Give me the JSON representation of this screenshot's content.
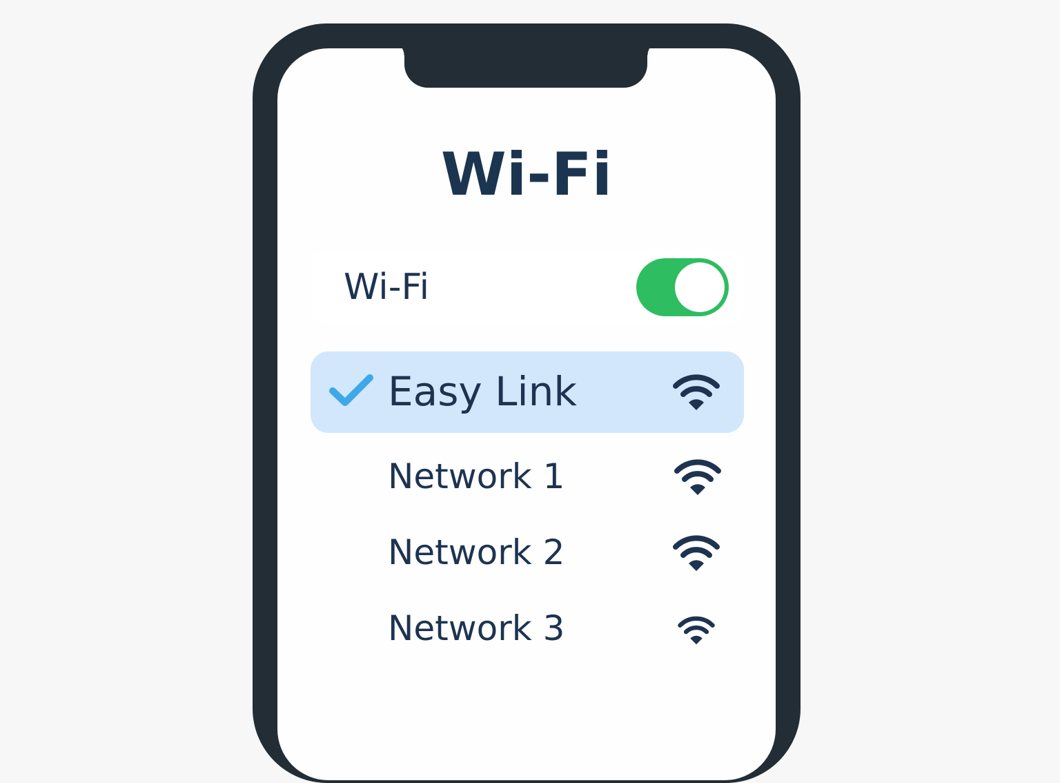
{
  "header": {
    "title": "Wi-Fi"
  },
  "wifi_toggle": {
    "label": "Wi-Fi",
    "enabled": true
  },
  "networks": [
    {
      "name": "Easy Link",
      "connected": true,
      "signal_icon": "wifi-signal-icon"
    },
    {
      "name": "Network 1",
      "connected": false,
      "signal_icon": "wifi-signal-icon"
    },
    {
      "name": "Network 2",
      "connected": false,
      "signal_icon": "wifi-signal-icon"
    },
    {
      "name": "Network 3",
      "connected": false,
      "signal_icon": "wifi-signal-icon"
    }
  ],
  "colors": {
    "accent_green": "#2ebd60",
    "selected_row": "#d2e7fb",
    "check_blue": "#3ea8e8",
    "text_dark": "#1d3350",
    "frame": "#222d35"
  }
}
